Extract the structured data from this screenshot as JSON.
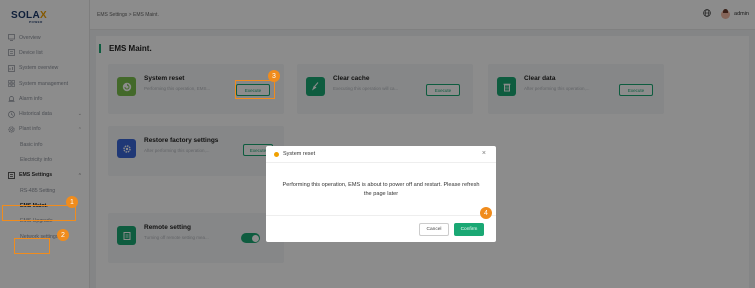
{
  "brand": {
    "logo_main_a": "SOLA",
    "logo_main_x": "X",
    "logo_sub": "POWER"
  },
  "breadcrumb": "EMS Settings  >  EMS Maint.",
  "user": {
    "name": "admin"
  },
  "sidebar": {
    "items": [
      {
        "label": "Overview",
        "icon": "monitor-icon"
      },
      {
        "label": "Device list",
        "icon": "list-icon"
      },
      {
        "label": "System overview",
        "icon": "chart-icon"
      },
      {
        "label": "System management",
        "icon": "grid-icon"
      },
      {
        "label": "Alarm info",
        "icon": "alarm-icon"
      },
      {
        "label": "Historical data",
        "icon": "clock-icon"
      },
      {
        "label": "Plant info",
        "icon": "gear-icon"
      },
      {
        "label": "Basic info"
      },
      {
        "label": "Electricity info"
      },
      {
        "label": "EMS Settings",
        "icon": "settings-icon"
      },
      {
        "label": "RS-485 Setting"
      },
      {
        "label": "EMS Maint."
      },
      {
        "label": "EMS Upgrade"
      },
      {
        "label": "Network settings"
      }
    ]
  },
  "main": {
    "title": "EMS Maint.",
    "cards": [
      {
        "title": "System reset",
        "desc": "Performing this operation, EMS...",
        "button": "Execute",
        "icon": "reset-icon",
        "color": "#7bbf4e"
      },
      {
        "title": "Clear cache",
        "desc": "Executing this operation will ca...",
        "button": "Execute",
        "icon": "broom-icon",
        "color": "#1aa874"
      },
      {
        "title": "Clear data",
        "desc": "After performing this operation,...",
        "button": "Execute",
        "icon": "trash-icon",
        "color": "#1aa874"
      },
      {
        "title": "Restore factory settings",
        "desc": "After performing this operation,...",
        "button": "Execute",
        "icon": "restore-icon",
        "color": "#3a67d8"
      },
      {
        "title": "Remote setting",
        "desc": "Turning off remote setting mea...",
        "icon": "remote-icon",
        "color": "#1aa874"
      }
    ]
  },
  "modal": {
    "title": "System reset",
    "message": "Performing this operation, EMS is about to power off and restart. Please refresh the page later",
    "cancel": "Cancel",
    "confirm": "Confirm"
  },
  "annotations": [
    "1",
    "2",
    "3",
    "4"
  ],
  "colors": {
    "accent": "#1aa874",
    "highlight": "#f08c1d",
    "warning_dot": "#f0a000"
  }
}
